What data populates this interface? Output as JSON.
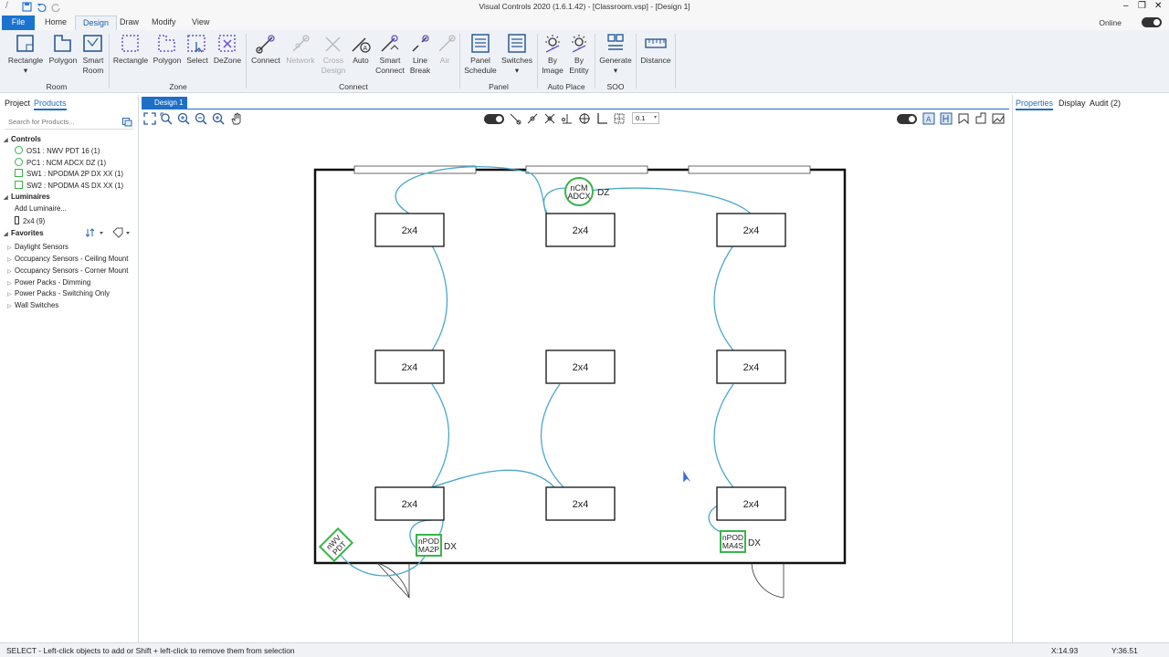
{
  "app": {
    "title": "Visual Controls 2020 (1.6.1.42) - [Classroom.vsp] - [Design 1]",
    "online_label": "Online"
  },
  "menu": [
    "File",
    "Home",
    "Design",
    "Draw",
    "Modify",
    "View"
  ],
  "ribbon": {
    "room": {
      "group": "Room",
      "buttons": [
        "Rectangle",
        "Polygon",
        "Smart Room"
      ]
    },
    "zone": {
      "group": "Zone",
      "buttons": [
        "Rectangle",
        "Polygon",
        "Select",
        "DeZone"
      ]
    },
    "connect": {
      "group": "Connect",
      "buttons": [
        "Connect",
        "Network",
        "Cross Design",
        "Auto",
        "Smart Connect",
        "Line Break",
        "Air"
      ]
    },
    "panel": {
      "group": "Panel",
      "buttons": [
        "Panel Schedule",
        "Switches"
      ]
    },
    "autoplace": {
      "group": "Auto Place",
      "buttons": [
        "By Image",
        "By Entity"
      ]
    },
    "soo": {
      "group": "SOO",
      "buttons": [
        "Generate"
      ]
    },
    "distance": {
      "buttons": [
        "Distance"
      ]
    }
  },
  "left_panel": {
    "tabs": [
      "Project",
      "Products"
    ],
    "search_placeholder": "Search for Products...",
    "controls_header": "Controls",
    "controls": [
      "OS1 : NWV PDT 16 (1)",
      "PC1 : NCM ADCX DZ (1)",
      "SW1 : NPODMA 2P DX XX (1)",
      "SW2 : NPODMA 4S DX XX (1)"
    ],
    "luminaires_header": "Luminaires",
    "add_luminaire": "Add Luminaire...",
    "luminaires": [
      "2x4 (9)"
    ],
    "favorites_header": "Favorites",
    "favorites": [
      "Daylight Sensors",
      "Occupancy Sensors - Ceiling Mount",
      "Occupancy Sensors - Corner Mount",
      "Power Packs - Dimming",
      "Power Packs - Switching Only",
      "Wall Switches"
    ]
  },
  "design_tab": "Design 1",
  "toolbar": {
    "grid_value": "0.1"
  },
  "drawing": {
    "fixture_label": "2x4",
    "fixture_count": 9,
    "devices": {
      "pc1": {
        "line1": "nCM",
        "line2": "ADCX",
        "suffix": "DZ"
      },
      "os1": {
        "line1": "nWV",
        "line2": "PDT"
      },
      "sw1": {
        "line1": "nPOD",
        "line2": "MA2P",
        "suffix": "DX"
      },
      "sw2": {
        "line1": "nPOD",
        "line2": "MA4S",
        "suffix": "DX"
      }
    },
    "wire_color": "#4aa8cc",
    "device_color": "#39b54a"
  },
  "right_panel": {
    "tabs": [
      "Properties",
      "Display",
      "Audit (2)"
    ]
  },
  "status": {
    "message": "SELECT - Left-click objects to add or Shift + left-click to remove them from selection",
    "x": "X:14.93",
    "y": "Y:36.51"
  }
}
